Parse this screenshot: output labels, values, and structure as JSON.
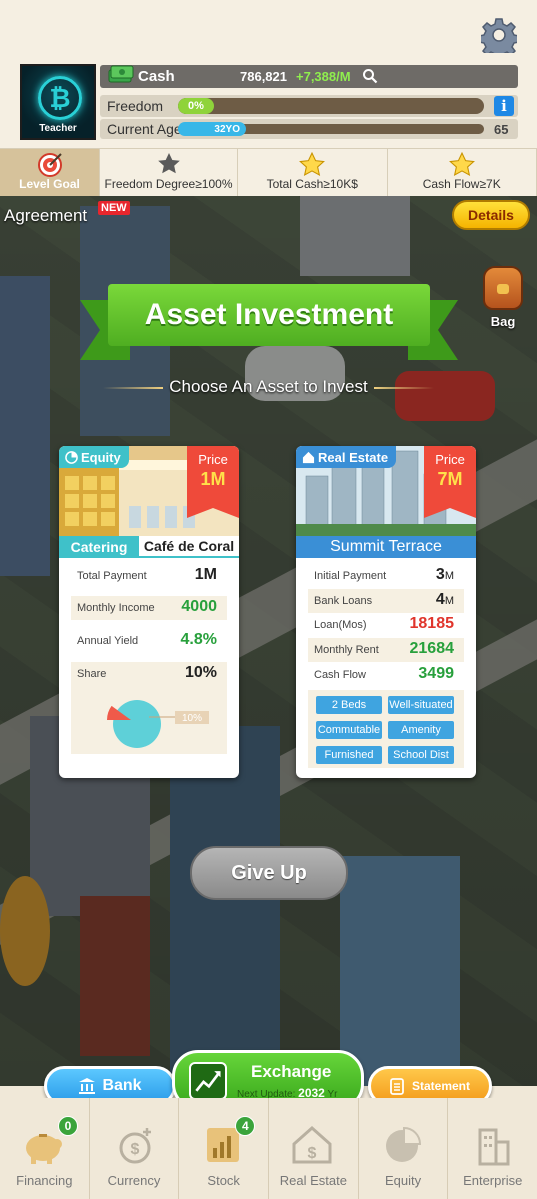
{
  "header": {
    "avatar_role": "Teacher",
    "cash_label": "Cash",
    "cash_amount": "786,821",
    "cash_rate": "+7,388/M",
    "freedom_label": "Freedom",
    "freedom_value": "0%",
    "freedom_progress": 0,
    "info_label": "i",
    "age_label": "Current Age",
    "age_value": "32YO",
    "age_max": "65"
  },
  "goals": [
    {
      "label": "Level Goal",
      "icon": "target-icon",
      "active": true
    },
    {
      "label": "Freedom Degree≥100%",
      "icon": "star-icon"
    },
    {
      "label": "Total Cash≥10K$",
      "icon": "star-icon"
    },
    {
      "label": "Cash Flow≥7K",
      "icon": "star-icon"
    }
  ],
  "overlay": {
    "agreement": "Agreement",
    "new_badge": "NEW",
    "details": "Details",
    "bag": "Bag",
    "title": "Asset Investment",
    "subtitle": "Choose An Asset to Invest",
    "give_up": "Give Up"
  },
  "equity_card": {
    "tag": "Equity",
    "price_label": "Price",
    "price_value": "1M",
    "category": "Catering",
    "name": "Café de Coral",
    "rows": [
      {
        "label": "Total Payment",
        "value": "1M"
      },
      {
        "label": "Monthly Income",
        "value": "4000"
      },
      {
        "label": "Annual Yield",
        "value": "4.8%"
      },
      {
        "label": "Share",
        "value": "10%"
      }
    ],
    "pie_label": "10%",
    "share_fraction": 0.1
  },
  "realestate_card": {
    "tag": "Real Estate",
    "price_label": "Price",
    "price_value": "7M",
    "name": "Summit Terrace",
    "rows": [
      {
        "label": "Initial Payment",
        "value": "3",
        "unit": "M"
      },
      {
        "label": "Bank Loans",
        "value": "4",
        "unit": "M"
      },
      {
        "label": "Loan(Mos)",
        "value": "18185"
      },
      {
        "label": "Monthly Rent",
        "value": "21684"
      },
      {
        "label": "Cash Flow",
        "value": "3499"
      }
    ],
    "features": [
      "2 Beds",
      "Well-situated",
      "Commutable",
      "Amenity",
      "Furnished",
      "School Dist"
    ]
  },
  "actions": {
    "bank": "Bank",
    "exchange_title": "Exchange",
    "exchange_sub_label": "Next Update:",
    "exchange_sub_value": "2032",
    "exchange_sub_unit": "Yr",
    "statement": "Statement"
  },
  "nav": [
    {
      "label": "Financing",
      "icon": "piggy-bank-icon",
      "badge": "0"
    },
    {
      "label": "Currency",
      "icon": "coins-icon"
    },
    {
      "label": "Stock",
      "icon": "stock-chart-icon",
      "badge": "4"
    },
    {
      "label": "Real Estate",
      "icon": "building-icon"
    },
    {
      "label": "Equity",
      "icon": "pie-chart-icon"
    },
    {
      "label": "Enterprise",
      "icon": "skyscraper-icon"
    }
  ],
  "colors": {
    "green": "#28a03c",
    "red": "#e0352c",
    "teal": "#3fc1c9",
    "blue": "#3a8fd6"
  }
}
